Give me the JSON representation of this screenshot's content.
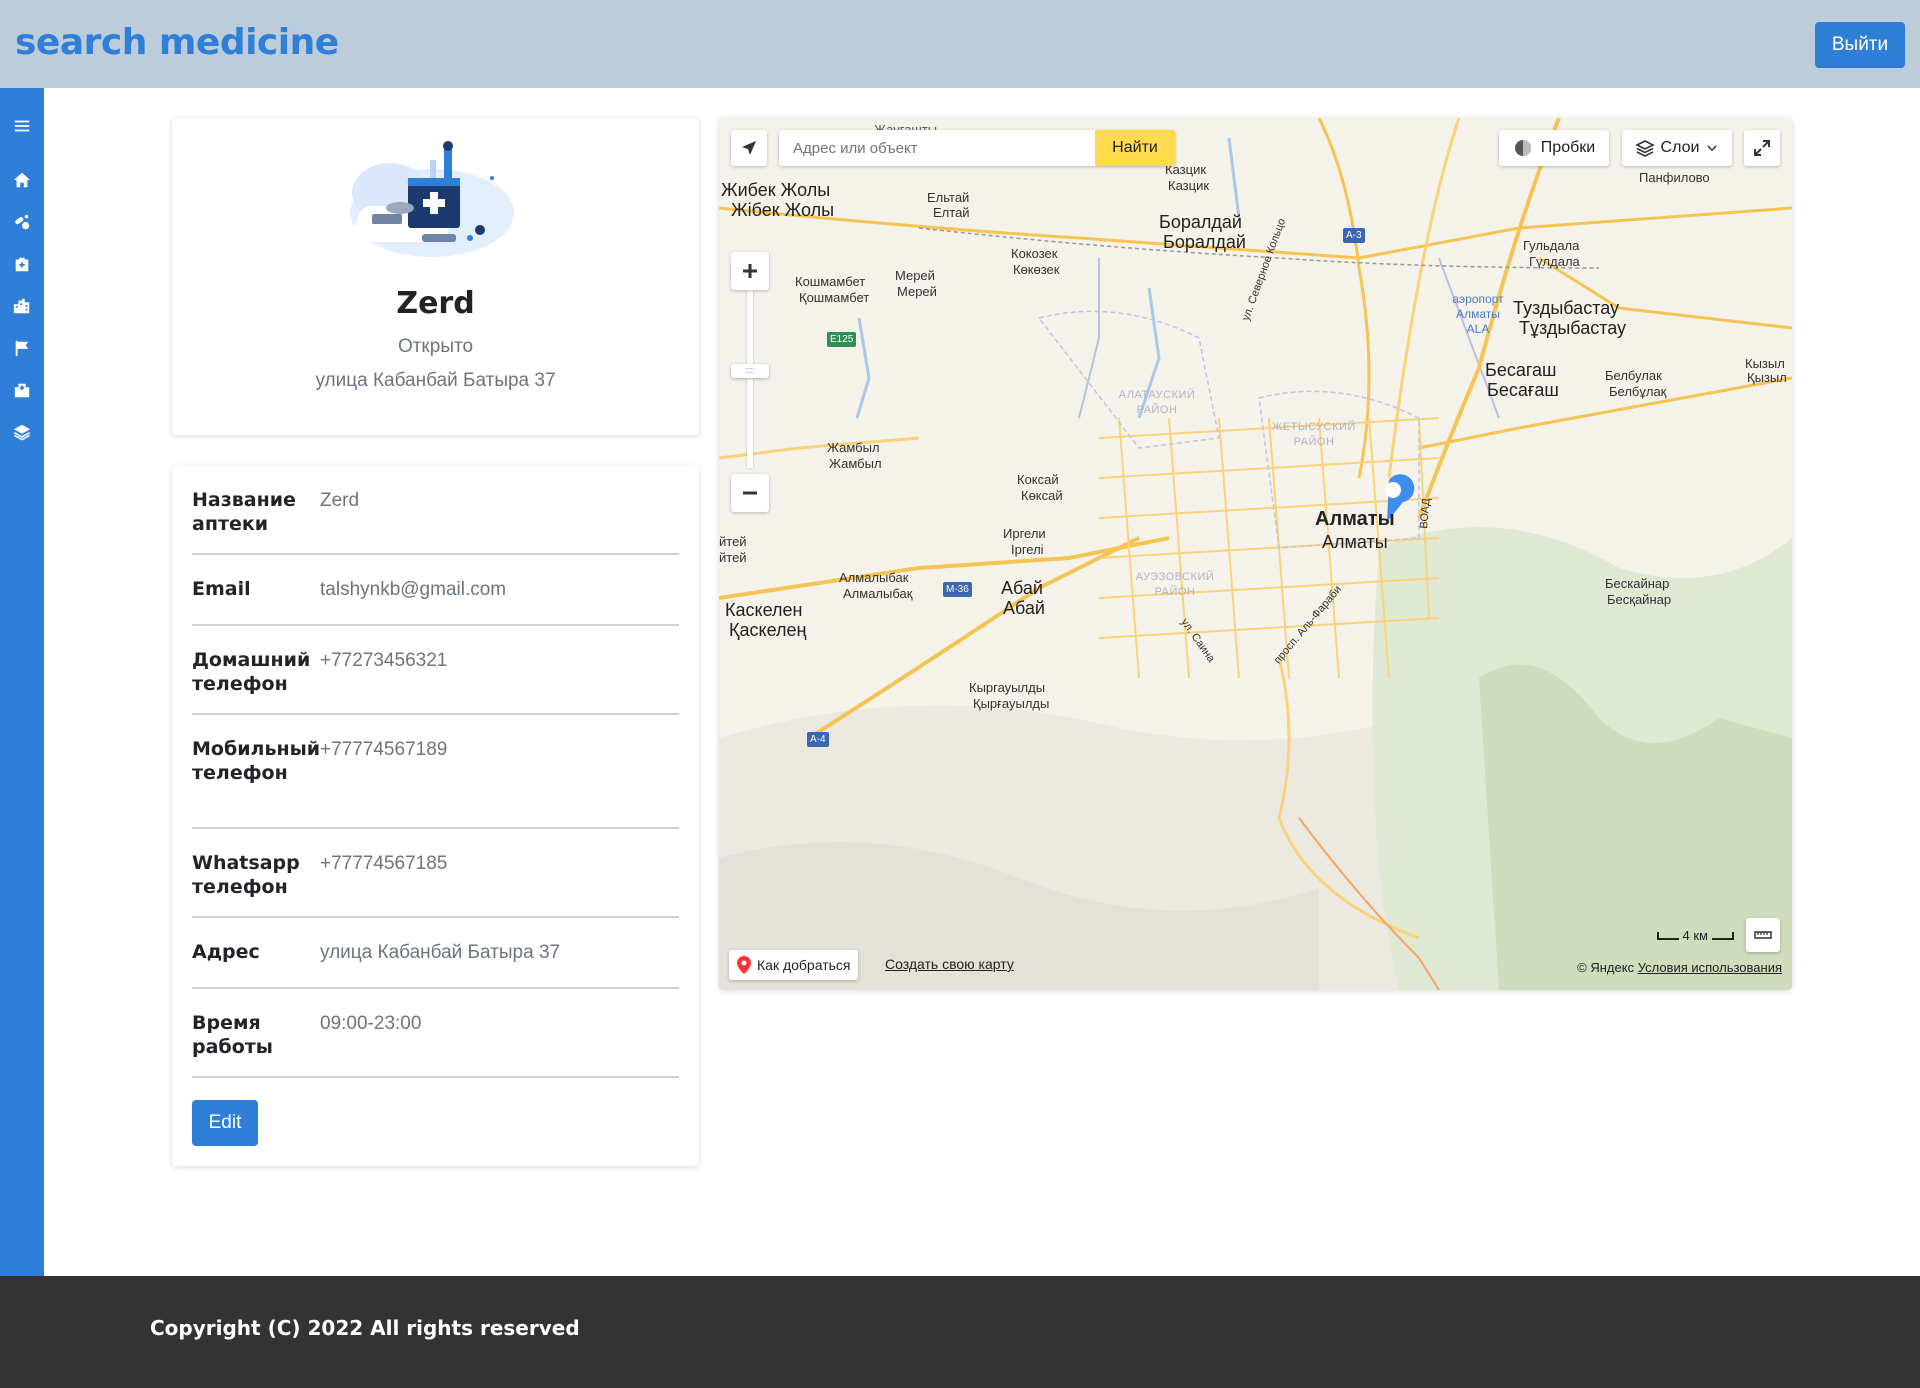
{
  "header": {
    "brand": "search medicine",
    "logout_label": "Выйти"
  },
  "sidebar": {
    "items": [
      {
        "icon": "menu-icon"
      },
      {
        "icon": "home-icon"
      },
      {
        "icon": "pills-icon"
      },
      {
        "icon": "first-aid-kit-icon"
      },
      {
        "icon": "city-icon"
      },
      {
        "icon": "flag-icon"
      },
      {
        "icon": "hospital-icon"
      },
      {
        "icon": "layers-icon"
      }
    ]
  },
  "profile": {
    "name": "Zerd",
    "status": "Открыто",
    "address": "улица Кабанбай Батыра 37"
  },
  "details": {
    "rows": [
      {
        "label": "Название аптеки",
        "value": "Zerd"
      },
      {
        "label": "Email",
        "value": "talshynkb@gmail.com"
      },
      {
        "label": "Домашний телефон",
        "value": "+77273456321"
      },
      {
        "label": "Мобильный телефон",
        "value": "+77774567189"
      },
      {
        "label": "Whatsapp телефон",
        "value": "+77774567185"
      },
      {
        "label": "Адрес",
        "value": "улица Кабанбай Батыра 37"
      },
      {
        "label": "Время работы",
        "value": "09:00-23:00"
      }
    ],
    "edit_label": "Edit"
  },
  "map": {
    "search_placeholder": "Адрес или объект",
    "search_button": "Найти",
    "traffic_label": "Пробки",
    "layers_label": "Слои",
    "route_label": "Как добраться",
    "create_map_label": "Создать свою карту",
    "copyright_prefix": "© Яндекс",
    "terms_label": "Условия использования",
    "scale_label": "4 км",
    "labels": {
      "zhibek_ru": "Жибек Жолы",
      "zhibek_kz": "Жібек Жолы",
      "yeltay_ru": "Ельтай",
      "yeltay_kz": "Елтай",
      "kazcik_ru": "Казцик",
      "kazcik_kz": "Казцик",
      "boraldai_ru": "Боралдай",
      "boraldai_kz": "Боралдай",
      "panfilovo": "Панфилово",
      "kokozek_ru": "Кокозек",
      "kokozek_kz": "Көкөзек",
      "koshmambet_ru": "Кошмамбет",
      "koshmambet_kz": "Қошмамбет",
      "merei_ru": "Мерей",
      "merei_kz": "Мерей",
      "guldala_ru": "Гульдала",
      "guldala_kz": "Гүлдала",
      "airport": "аэропорт Алматы ALA",
      "tuzdybastau_ru": "Туздыбастау",
      "tuzdybastau_kz": "Тұздыбастау",
      "besagash_ru": "Бесагаш",
      "besagash_kz": "Бесағаш",
      "belbulak_ru": "Белбулак",
      "belbulak_kz": "Белбұлақ",
      "kyzyl_ru": "Кызыл",
      "kyzyl_kz": "Қызыл",
      "alatau_district": "АЛАТАУСКИЙ РАЙОН",
      "zhetysu_district": "ЖЕТЫСУСКИЙ РАЙОН",
      "auezov_district": "АУЭЗОВСКИЙ РАЙОН",
      "zhambyl_ru": "Жамбыл",
      "zhambyl_kz": "Жамбыл",
      "koksai_ru": "Коксай",
      "koksai_kz": "Көксай",
      "irgeli_ru": "Иргели",
      "irgeli_kz": "Іргелі",
      "almaty_ru": "Алматы",
      "almaty_kz": "Алматы",
      "almalybak_ru": "Алмалыбак",
      "almalybak_kz": "Алмалыбақ",
      "abai_ru": "Абай",
      "abai_kz": "Абай",
      "kaskelen_ru": "Каскелен",
      "kaskelen_kz": "Қаскелең",
      "besqainar_ru": "Бескайнар",
      "besqainar_kz": "Бесқайнар",
      "kyrgauldy_ru": "Кыргауылды",
      "kyrgauldy_kz": "Қырғауылды",
      "teyte_ru": "йтей",
      "teyte_kz": "йтей",
      "zhaugashty": "Жаугашты",
      "severnoe_koltso": "ул. Северное Кольцо",
      "sain": "ул. Саина",
      "alfarabi": "просп. Аль-Фараби",
      "vaad": "ВОАД",
      "road_a3": "A-3",
      "road_e125": "E125",
      "road_m36": "M-36",
      "road_a4": "A-4"
    }
  },
  "footer": {
    "text": "Copyright (C) 2022 All rights reserved"
  }
}
